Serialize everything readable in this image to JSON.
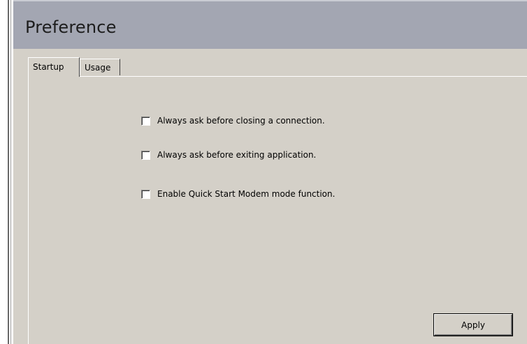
{
  "window": {
    "title": "Preference"
  },
  "tabs": [
    {
      "label": "Startup",
      "active": true
    },
    {
      "label": "Usage",
      "active": false
    }
  ],
  "options": [
    {
      "label": "Always ask before closing a connection.",
      "checked": false
    },
    {
      "label": "Always ask before exiting application.",
      "checked": false
    },
    {
      "label": "Enable Quick Start Modem mode function.",
      "checked": false
    }
  ],
  "buttons": {
    "apply_label": "Apply"
  },
  "colors": {
    "header": "#a3a6b2",
    "panel": "#d4d0c8"
  }
}
